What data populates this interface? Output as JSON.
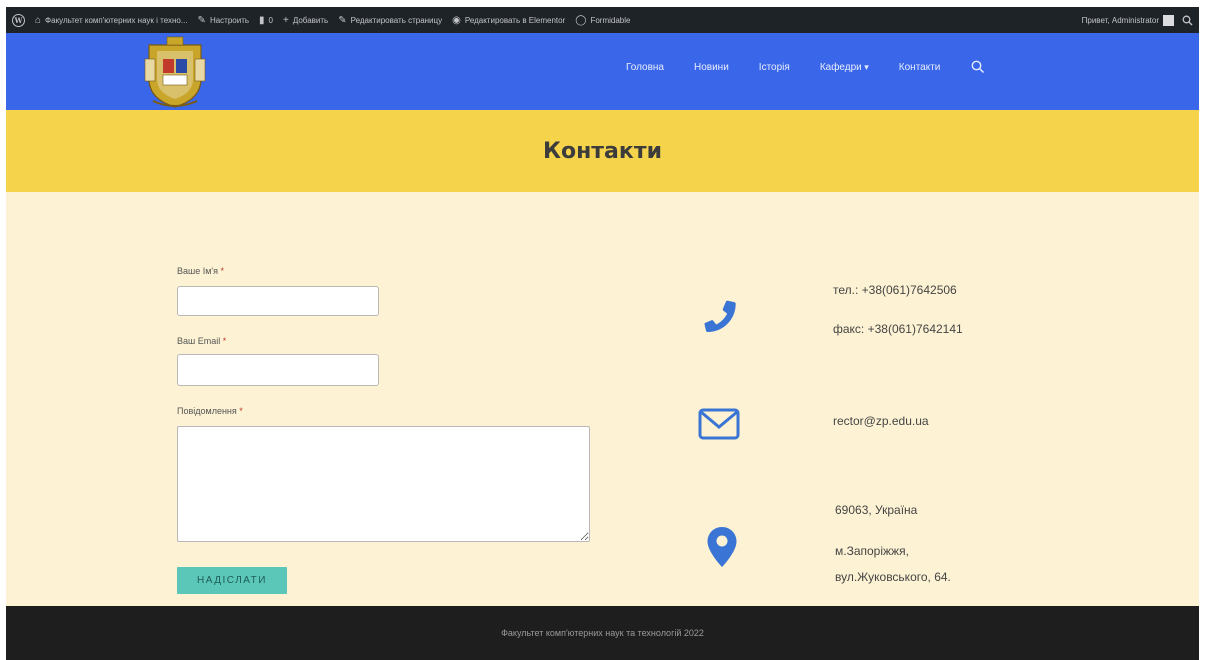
{
  "admin_bar": {
    "site_name": "Факультет комп'ютерних наук і техно...",
    "customize": "Настроить",
    "comments_count": "0",
    "add_new": "Добавить",
    "edit_page": "Редактировать страницу",
    "edit_elementor": "Редактировать в Elementor",
    "plugin_item": "Formidable",
    "greeting": "Привет, Administrator"
  },
  "nav": {
    "items": [
      {
        "label": "Головна"
      },
      {
        "label": "Новини"
      },
      {
        "label": "Історія"
      },
      {
        "label": "Кафедри"
      },
      {
        "label": "Контакти"
      }
    ]
  },
  "page": {
    "title": "Контакти"
  },
  "form": {
    "name_label": "Ваше Ім'я",
    "email_label": "Ваш Email",
    "message_label": "Повідомлення",
    "required_mark": "*",
    "name_value": "",
    "email_value": "",
    "message_value": "",
    "submit_label": "НАДІСЛАТИ"
  },
  "contacts": {
    "phone": "тел.: +38(061)7642506",
    "fax": "факс: +38(061)7642141",
    "email": "rector@zp.edu.ua",
    "postal": "69063, Україна",
    "city": "м.Запоріжжя,",
    "street": "вул.Жуковського, 64."
  },
  "footer": {
    "text": "Факультет комп'ютерних наук та технологій 2022"
  },
  "colors": {
    "admin_bar": "#1d2327",
    "header": "#3a66ea",
    "title_band": "#f5d44b",
    "content_bg": "#fdf3d4",
    "icon_blue": "#3a74d4",
    "submit_bg": "#5bc7b9",
    "footer": "#1e1e1e"
  },
  "icons": [
    "wordpress-logo-icon",
    "home-icon",
    "brush-icon",
    "comment-icon",
    "plus-icon",
    "pencil-icon",
    "elementor-icon",
    "formidable-icon",
    "search-icon",
    "phone-icon",
    "envelope-icon",
    "map-pin-icon"
  ]
}
